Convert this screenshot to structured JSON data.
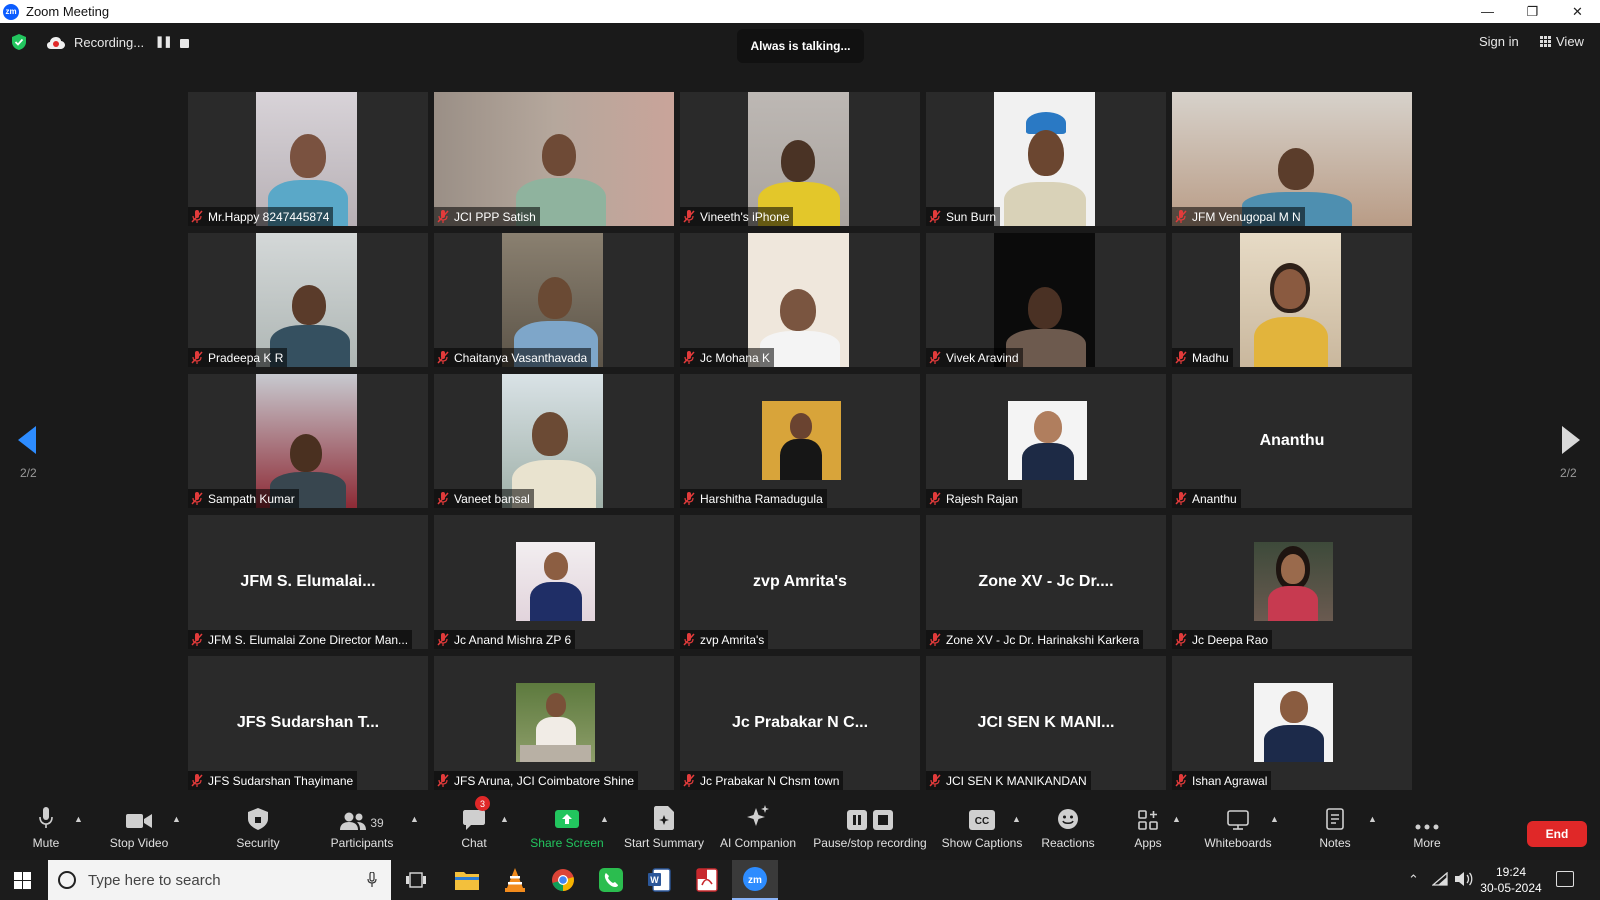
{
  "window": {
    "title": "Zoom Meeting",
    "logo": "zm"
  },
  "topbar": {
    "recording_label": "Recording...",
    "talking": "Alwas is talking...",
    "sign_in": "Sign in",
    "view": "View"
  },
  "pager": {
    "left": "2/2",
    "right": "2/2"
  },
  "participants": [
    {
      "name": "Mr.Happy 8247445874"
    },
    {
      "name": "JCI PPP Satish"
    },
    {
      "name": "Vineeth's iPhone"
    },
    {
      "name": "Sun Burn"
    },
    {
      "name": "JFM Venugopal M N"
    },
    {
      "name": "Pradeepa K R"
    },
    {
      "name": "Chaitanya Vasanthavada"
    },
    {
      "name": "Jc Mohana K"
    },
    {
      "name": "Vivek Aravind"
    },
    {
      "name": "Madhu"
    },
    {
      "name": "Sampath Kumar"
    },
    {
      "name": "Vaneet bansal"
    },
    {
      "name": "Harshitha Ramadugula"
    },
    {
      "name": "Rajesh Rajan"
    },
    {
      "name": "Ananthu",
      "display": "Ananthu"
    },
    {
      "name": "JFM S. Elumalai Zone Director Man...",
      "display": "JFM S. Elumalai..."
    },
    {
      "name": "Jc Anand Mishra ZP 6"
    },
    {
      "name": "zvp Amrita's",
      "display": "zvp Amrita's"
    },
    {
      "name": "Zone XV - Jc Dr. Harinakshi Karkera",
      "display": "Zone XV - Jc Dr...."
    },
    {
      "name": "Jc Deepa Rao"
    },
    {
      "name": "JFS Sudarshan Thayimane",
      "display": "JFS Sudarshan T..."
    },
    {
      "name": "JFS Aruna, JCI Coimbatore Shine"
    },
    {
      "name": "Jc Prabakar N Chsm town",
      "display": "Jc Prabakar N C..."
    },
    {
      "name": "JCI SEN K MANIKANDAN",
      "display": "JCI SEN K MANI..."
    },
    {
      "name": "Ishan Agrawal"
    }
  ],
  "toolbar": {
    "mute": "Mute",
    "stop_video": "Stop Video",
    "security": "Security",
    "participants": "Participants",
    "participants_count": "39",
    "chat": "Chat",
    "chat_badge": "3",
    "share_screen": "Share Screen",
    "start_summary": "Start Summary",
    "ai_companion": "AI Companion",
    "pause_recording": "Pause/stop recording",
    "show_captions": "Show Captions",
    "reactions": "Reactions",
    "apps": "Apps",
    "whiteboards": "Whiteboards",
    "notes": "Notes",
    "more": "More",
    "end": "End"
  },
  "taskbar": {
    "search_placeholder": "Type here to search",
    "time": "19:24",
    "date": "30-05-2024"
  },
  "colors": {
    "accent": "#0b5cff",
    "share_green": "#22c55e",
    "end_red": "#e02828"
  }
}
